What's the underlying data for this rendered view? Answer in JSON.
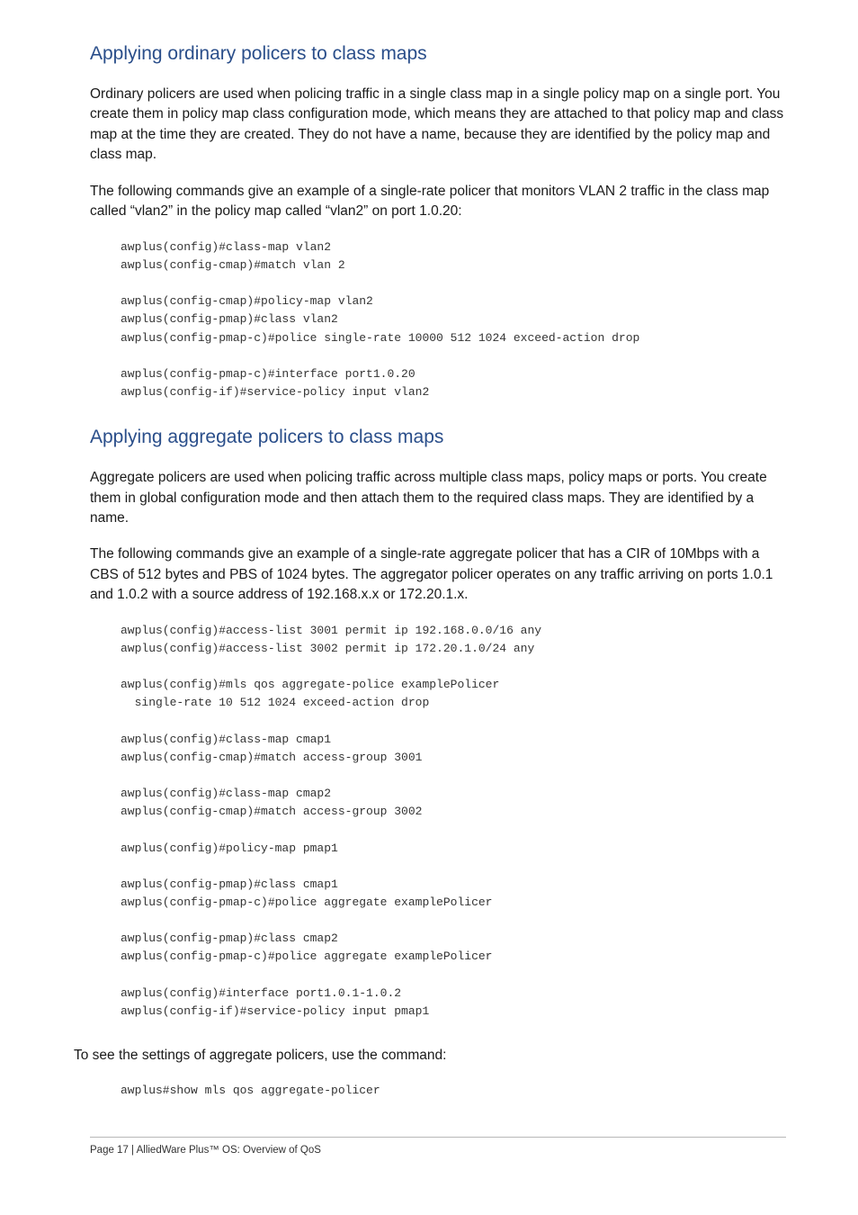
{
  "section1": {
    "heading": "Applying ordinary policers to class maps",
    "para1": "Ordinary policers are used when policing traffic in a single class map in a single policy map on a single port. You create them in policy map class configuration mode, which means they are attached to that policy map and class map at the time they are created. They do not have a name, because they are identified by the policy map and class map.",
    "para2": "The following commands give an example of a single-rate policer that monitors VLAN 2 traffic in the class map called “vlan2” in the policy map called “vlan2” on port 1.0.20:",
    "code": "awplus(config)#class-map vlan2\nawplus(config-cmap)#match vlan 2\n\nawplus(config-cmap)#policy-map vlan2\nawplus(config-pmap)#class vlan2\nawplus(config-pmap-c)#police single-rate 10000 512 1024 exceed-action drop\n\nawplus(config-pmap-c)#interface port1.0.20\nawplus(config-if)#service-policy input vlan2"
  },
  "section2": {
    "heading": "Applying aggregate policers to class maps",
    "para1": "Aggregate policers are used when policing traffic across multiple class maps, policy maps or ports. You create them in global configuration mode and then attach them to the required class maps. They are identified by a name.",
    "para2": "The following commands give an example of a single-rate aggregate policer that has a CIR of 10Mbps with a CBS of 512 bytes and PBS of 1024 bytes. The aggregator policer operates on any traffic arriving on ports 1.0.1 and 1.0.2 with a source address of 192.168.x.x or 172.20.1.x.",
    "code": "awplus(config)#access-list 3001 permit ip 192.168.0.0/16 any\nawplus(config)#access-list 3002 permit ip 172.20.1.0/24 any\n\nawplus(config)#mls qos aggregate-police examplePolicer\n  single-rate 10 512 1024 exceed-action drop\n\nawplus(config)#class-map cmap1\nawplus(config-cmap)#match access-group 3001\n\nawplus(config)#class-map cmap2\nawplus(config-cmap)#match access-group 3002\n\nawplus(config)#policy-map pmap1\n\nawplus(config-pmap)#class cmap1\nawplus(config-pmap-c)#police aggregate examplePolicer\n\nawplus(config-pmap)#class cmap2\nawplus(config-pmap-c)#police aggregate examplePolicer\n\nawplus(config)#interface port1.0.1-1.0.2\nawplus(config-if)#service-policy input pmap1",
    "para3": "To see the settings of aggregate policers, use the command:",
    "code2": "awplus#show mls qos aggregate-policer"
  },
  "footer": {
    "text": "Page 17 | AlliedWare Plus™ OS: Overview of QoS"
  }
}
